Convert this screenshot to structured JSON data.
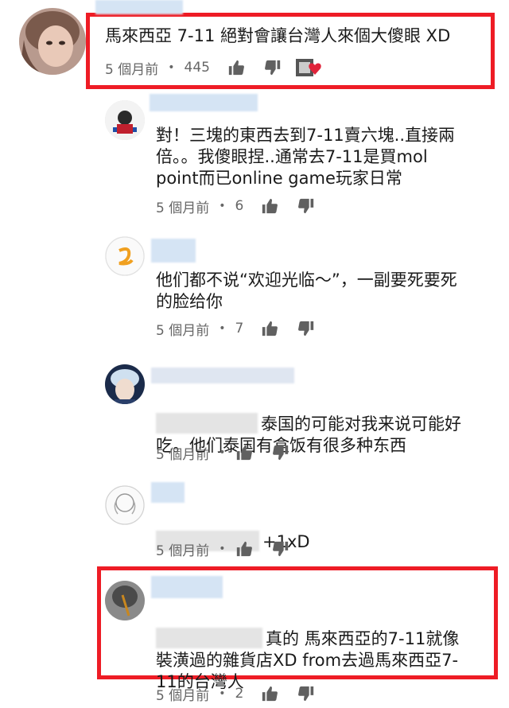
{
  "comments": [
    {
      "text": "馬來西亞 7-11 絕對會讓台灣人來個大傻眼 XD",
      "time": "5 個月前",
      "likes": "445",
      "mention": ""
    },
    {
      "text": "對！三塊的東西去到7-11賣六塊..直接兩\n倍。。我傻眼捏..通常去7-11是買mol\npoint而已online game玩家日常",
      "time": "5 個月前",
      "likes": "6",
      "mention": ""
    },
    {
      "text": "他们都不说“欢迎光临～”，一副要死要死\n的脸给你",
      "time": "5 個月前",
      "likes": "7",
      "mention": ""
    },
    {
      "line1": "泰国的可能对我来说可能好",
      "line2": "吃。他们泰国有盒饭有很多种东西",
      "time": "5 個月前",
      "likes": "",
      "mention": "hidden"
    },
    {
      "line1": "+1xD",
      "time": "5 個月前",
      "likes": "",
      "mention": "hidden"
    },
    {
      "line1": "真的 馬來西亞的7-11就像",
      "line2": "裝潢過的雜貨店XD from去過馬來西亞7-",
      "line3": "11的台灣人",
      "time": "5 個月前",
      "likes": "2",
      "mention": "hidden"
    }
  ],
  "colors": {
    "highlight": "#ee1c25",
    "name_blur": "#d5e4f4",
    "heart": "#e0243a"
  },
  "icons": {
    "like": "thumbs-up-icon",
    "dislike": "thumbs-down-icon",
    "creator_heart": "creator-heart-icon"
  }
}
